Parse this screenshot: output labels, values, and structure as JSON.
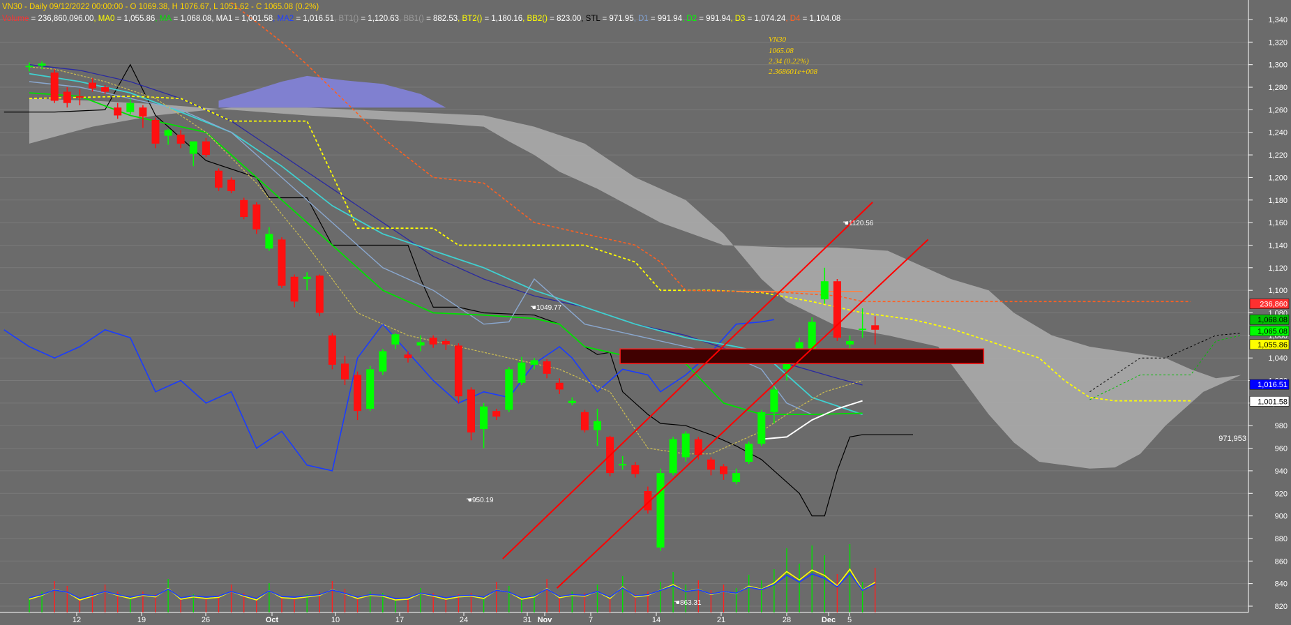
{
  "header": {
    "symbol": "VN30",
    "period": "Daily",
    "datetime": "09/12/2022 00:00:00",
    "ohlc": "O 1069.38, H 1076.67, L 1051.62 - C 1065.08 (0.2%)",
    "indicators": [
      {
        "label": "Volume",
        "value": "236,860,096.00",
        "color": "#ff3030"
      },
      {
        "label": "MA0",
        "value": "1,055.86",
        "color": "#ffff00"
      },
      {
        "label": "MA",
        "value": "1,068.08",
        "color": "#00e000"
      },
      {
        "label": "MA1",
        "value": "1,001.58",
        "color": "#ffffff"
      },
      {
        "label": "MA2",
        "value": "1,016.51",
        "color": "#2040ff"
      },
      {
        "label": "BT1()",
        "value": "1,120.63",
        "color": "#9a9a9a"
      },
      {
        "label": "BB1()",
        "value": "882.53",
        "color": "#9a9a9a"
      },
      {
        "label": "BT2()",
        "value": "1,180.16",
        "color": "#ffff00"
      },
      {
        "label": "BB2()",
        "value": "823.00",
        "color": "#ffff00"
      },
      {
        "label": "STL",
        "value": "971.95",
        "color": "#000000"
      },
      {
        "label": "D1",
        "value": "991.94",
        "color": "#80a0d0"
      },
      {
        "label": "D2",
        "value": "991.94",
        "color": "#00ff00"
      },
      {
        "label": "D3",
        "value": "1,074.24",
        "color": "#ffff00"
      },
      {
        "label": "D4",
        "value": "1,104.08",
        "color": "#ff6020"
      }
    ]
  },
  "info_box": {
    "symbol": "VN30",
    "close": "1065.08",
    "change": "2.34 (0.22%)",
    "volume": "2.368601e+008"
  },
  "annotations": {
    "high_peak": "1120.56",
    "mid_peak": "1049.77",
    "low_1": "950.19",
    "low_2": "863.31",
    "stl_value": "971,953"
  },
  "price_tags": [
    {
      "text": "236,860",
      "price": 1088,
      "bg": "#ff3030",
      "fg": "#ffffff"
    },
    {
      "text": "1,068.08",
      "price": 1074,
      "bg": "#00c000",
      "fg": "#000000"
    },
    {
      "text": "1,065.08",
      "price": 1064,
      "bg": "#00ff00",
      "fg": "#000000"
    },
    {
      "text": "1,055.86",
      "price": 1052,
      "bg": "#ffff00",
      "fg": "#000000"
    },
    {
      "text": "1,016.51",
      "price": 1016.5,
      "bg": "#0000ff",
      "fg": "#ffffff"
    },
    {
      "text": "1,001.58",
      "price": 1001.6,
      "bg": "#ffffff",
      "fg": "#000000"
    }
  ],
  "colors": {
    "background": "#6b6b6b",
    "up_candle": "#00ff00",
    "down_candle": "#ff1010",
    "cloud": "#a8a8a8",
    "cloud_kumo": "#8080d0",
    "channel": "#ff0000"
  },
  "chart_data": {
    "type": "candlestick",
    "title": "VN30 - Daily",
    "x_tick_labels": [
      "12",
      "19",
      "26",
      "Oct",
      "10",
      "17",
      "24",
      "31",
      "Nov",
      "7",
      "14",
      "21",
      "28",
      "Dec",
      "5"
    ],
    "y_ticks": [
      820,
      840,
      860,
      880,
      900,
      920,
      940,
      960,
      980,
      1000,
      1020,
      1040,
      1060,
      1080,
      1100,
      1120,
      1140,
      1160,
      1180,
      1200,
      1220,
      1240,
      1260,
      1280,
      1300,
      1320,
      1340
    ],
    "ylim": [
      812,
      1352
    ],
    "candles": [
      {
        "o": 1298,
        "h": 1302,
        "l": 1294,
        "c": 1299
      },
      {
        "o": 1299,
        "h": 1303,
        "l": 1296,
        "c": 1301
      },
      {
        "o": 1293,
        "h": 1296,
        "l": 1266,
        "c": 1268
      },
      {
        "o": 1276,
        "h": 1280,
        "l": 1262,
        "c": 1266
      },
      {
        "o": 1272,
        "h": 1278,
        "l": 1264,
        "c": 1271
      },
      {
        "o": 1284,
        "h": 1288,
        "l": 1276,
        "c": 1279
      },
      {
        "o": 1280,
        "h": 1282,
        "l": 1274,
        "c": 1276
      },
      {
        "o": 1262,
        "h": 1266,
        "l": 1252,
        "c": 1255
      },
      {
        "o": 1258,
        "h": 1270,
        "l": 1256,
        "c": 1266
      },
      {
        "o": 1262,
        "h": 1264,
        "l": 1244,
        "c": 1254
      },
      {
        "o": 1251,
        "h": 1253,
        "l": 1226,
        "c": 1230
      },
      {
        "o": 1237,
        "h": 1243,
        "l": 1229,
        "c": 1242
      },
      {
        "o": 1238,
        "h": 1242,
        "l": 1226,
        "c": 1230
      },
      {
        "o": 1221,
        "h": 1226,
        "l": 1210,
        "c": 1232
      },
      {
        "o": 1232,
        "h": 1235,
        "l": 1218,
        "c": 1220
      },
      {
        "o": 1206,
        "h": 1208,
        "l": 1188,
        "c": 1191
      },
      {
        "o": 1198,
        "h": 1200,
        "l": 1186,
        "c": 1188
      },
      {
        "o": 1180,
        "h": 1182,
        "l": 1163,
        "c": 1165
      },
      {
        "o": 1176,
        "h": 1178,
        "l": 1150,
        "c": 1154
      },
      {
        "o": 1137,
        "h": 1156,
        "l": 1135,
        "c": 1150
      },
      {
        "o": 1145,
        "h": 1147,
        "l": 1102,
        "c": 1104
      },
      {
        "o": 1112,
        "h": 1114,
        "l": 1085,
        "c": 1090
      },
      {
        "o": 1110,
        "h": 1116,
        "l": 1100,
        "c": 1112
      },
      {
        "o": 1113,
        "h": 1114,
        "l": 1077,
        "c": 1080
      },
      {
        "o": 1060,
        "h": 1062,
        "l": 1030,
        "c": 1034
      },
      {
        "o": 1035,
        "h": 1042,
        "l": 1016,
        "c": 1021
      },
      {
        "o": 1025,
        "h": 1028,
        "l": 985,
        "c": 993
      },
      {
        "o": 995,
        "h": 1033,
        "l": 993,
        "c": 1030
      },
      {
        "o": 1028,
        "h": 1048,
        "l": 1025,
        "c": 1046
      },
      {
        "o": 1052,
        "h": 1062,
        "l": 1048,
        "c": 1061
      },
      {
        "o": 1043,
        "h": 1046,
        "l": 1036,
        "c": 1040
      },
      {
        "o": 1051,
        "h": 1060,
        "l": 1046,
        "c": 1054
      },
      {
        "o": 1058,
        "h": 1060,
        "l": 1049,
        "c": 1052
      },
      {
        "o": 1055,
        "h": 1057,
        "l": 1047,
        "c": 1052
      },
      {
        "o": 1051,
        "h": 1053,
        "l": 1000,
        "c": 1006
      },
      {
        "o": 1012,
        "h": 1014,
        "l": 967,
        "c": 974
      },
      {
        "o": 977,
        "h": 1000,
        "l": 960,
        "c": 997
      },
      {
        "o": 993,
        "h": 995,
        "l": 985,
        "c": 988
      },
      {
        "o": 994,
        "h": 1032,
        "l": 992,
        "c": 1030
      },
      {
        "o": 1018,
        "h": 1041,
        "l": 1016,
        "c": 1036
      },
      {
        "o": 1034,
        "h": 1040,
        "l": 1030,
        "c": 1038
      },
      {
        "o": 1037,
        "h": 1039,
        "l": 1022,
        "c": 1026
      },
      {
        "o": 1018,
        "h": 1022,
        "l": 1008,
        "c": 1012
      },
      {
        "o": 1000,
        "h": 1005,
        "l": 998,
        "c": 1002
      },
      {
        "o": 992,
        "h": 994,
        "l": 974,
        "c": 976
      },
      {
        "o": 976,
        "h": 995,
        "l": 962,
        "c": 984
      },
      {
        "o": 970,
        "h": 971,
        "l": 935,
        "c": 938
      },
      {
        "o": 946,
        "h": 953,
        "l": 941,
        "c": 946
      },
      {
        "o": 945,
        "h": 948,
        "l": 934,
        "c": 937
      },
      {
        "o": 922,
        "h": 926,
        "l": 902,
        "c": 905
      },
      {
        "o": 872,
        "h": 942,
        "l": 869,
        "c": 938
      },
      {
        "o": 938,
        "h": 970,
        "l": 936,
        "c": 968
      },
      {
        "o": 952,
        "h": 975,
        "l": 948,
        "c": 973
      },
      {
        "o": 968,
        "h": 970,
        "l": 950,
        "c": 954
      },
      {
        "o": 950,
        "h": 952,
        "l": 936,
        "c": 941
      },
      {
        "o": 944,
        "h": 946,
        "l": 932,
        "c": 937
      },
      {
        "o": 930,
        "h": 942,
        "l": 928,
        "c": 938
      },
      {
        "o": 948,
        "h": 966,
        "l": 946,
        "c": 964
      },
      {
        "o": 964,
        "h": 994,
        "l": 962,
        "c": 992
      },
      {
        "o": 992,
        "h": 1015,
        "l": 982,
        "c": 1012
      },
      {
        "o": 1030,
        "h": 1045,
        "l": 1020,
        "c": 1042
      },
      {
        "o": 1042,
        "h": 1058,
        "l": 1034,
        "c": 1054
      },
      {
        "o": 1040,
        "h": 1076,
        "l": 1036,
        "c": 1072
      },
      {
        "o": 1092,
        "h": 1120,
        "l": 1088,
        "c": 1108
      },
      {
        "o": 1108,
        "h": 1110,
        "l": 1055,
        "c": 1058
      },
      {
        "o": 1052,
        "h": 1060,
        "l": 1040,
        "c": 1055
      },
      {
        "o": 1065,
        "h": 1084,
        "l": 1058,
        "c": 1066
      },
      {
        "o": 1069,
        "h": 1077,
        "l": 1052,
        "c": 1065
      }
    ]
  }
}
